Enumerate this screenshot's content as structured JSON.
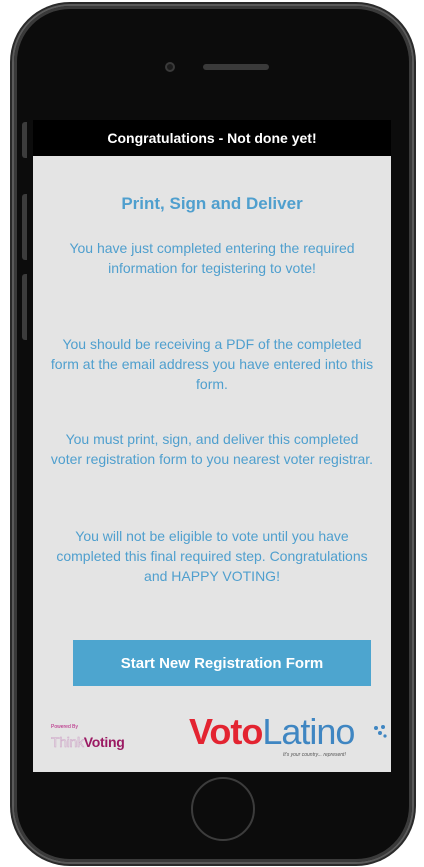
{
  "status_bar": {
    "title": "Congratulations - Not done yet!"
  },
  "main": {
    "heading": "Print, Sign and Deliver",
    "paragraphs": [
      "You have just completed entering the required information for tegistering to vote!",
      "You should be receiving a PDF of the completed form at the email address you have entered into this form.",
      "You must print, sign, and deliver this completed voter registration form to you nearest voter registrar.",
      "You will not be eligible to vote until you have completed this final required step. Congratulations and HAPPY VOTING!"
    ],
    "start_button_label": "Start New Registration Form"
  },
  "footer": {
    "powered_by": "Powered By",
    "think": "Think",
    "voting": "Voting",
    "voto": "Voto",
    "latino": "Latino",
    "tagline": "It's your country... represent!"
  },
  "colors": {
    "accent_text": "#4f9fce",
    "button": "#4da5cf",
    "screen_bg": "#e4e4e4",
    "voto_red": "#e32431",
    "latino_blue": "#3f86c2",
    "voting_purple": "#9b1a63"
  },
  "icons": {
    "camera": "front-camera-icon",
    "home": "home-button-icon"
  }
}
